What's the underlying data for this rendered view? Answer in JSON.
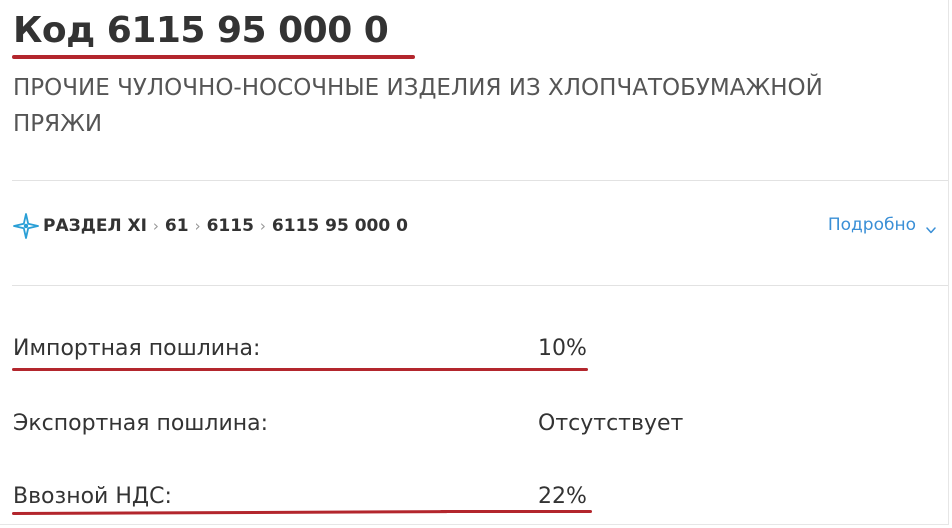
{
  "header": {
    "code_title": "Код 6115 95 000 0",
    "description": "ПРОЧИЕ ЧУЛОЧНО-НОСОЧНЫЕ ИЗДЕЛИЯ ИЗ ХЛОПЧАТОБУМАЖНОЙ ПРЯЖИ"
  },
  "breadcrumb": {
    "icon": "compass-star-icon",
    "items": [
      "РАЗДЕЛ XI",
      "61",
      "6115",
      "6115 95 000 0"
    ],
    "separator": "›",
    "more_label": "Подробно",
    "more_icon": "chevron-down-icon"
  },
  "duties": {
    "import": {
      "label": "Импортная пошлина:",
      "value": "10%"
    },
    "export": {
      "label": "Экспортная пошлина:",
      "value": "Отсутствует"
    },
    "vat": {
      "label": "Ввозной НДС:",
      "value": "22%"
    }
  },
  "colors": {
    "underline": "#b3262d",
    "link": "#3a8fd6",
    "icon": "#2a9fd6",
    "text": "#333333"
  }
}
